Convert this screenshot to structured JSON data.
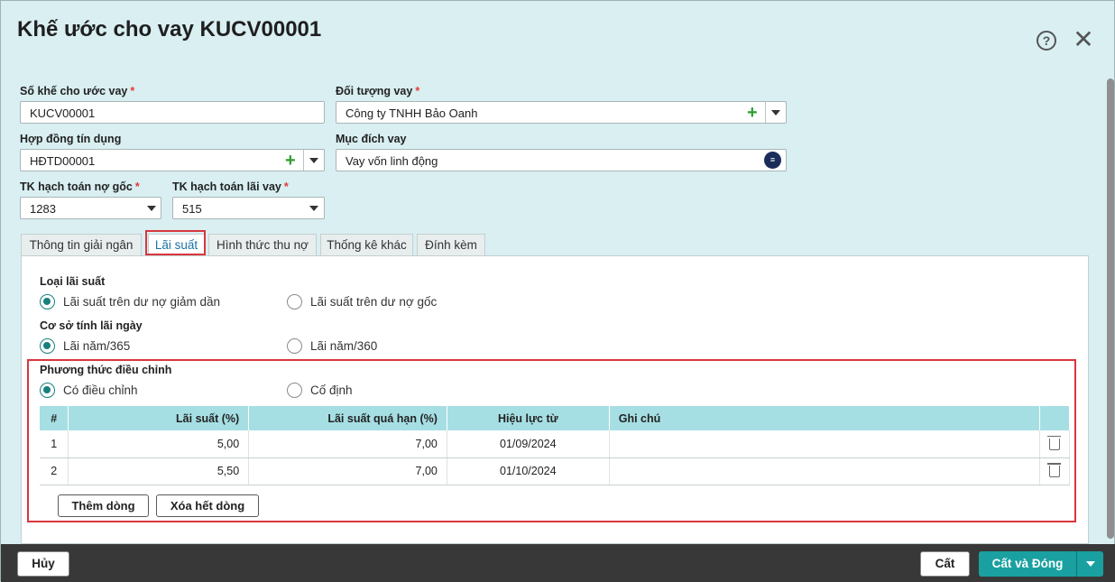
{
  "dialog": {
    "title": "Khế ước cho vay KUCV00001"
  },
  "form": {
    "so_khe_uoc": {
      "label": "Số khế cho ước vay",
      "value": "KUCV00001"
    },
    "doi_tuong_vay": {
      "label": "Đối tượng vay",
      "value": "Công ty TNHH Bảo Oanh"
    },
    "hop_dong": {
      "label": "Hợp đồng tín dụng",
      "value": "HĐTD00001"
    },
    "muc_dich": {
      "label": "Mục đích vay",
      "value": "Vay vốn linh động"
    },
    "tk_no_goc": {
      "label": "TK hạch toán nợ gốc",
      "value": "1283"
    },
    "tk_lai_vay": {
      "label": "TK hạch toán lãi vay",
      "value": "515"
    },
    "required_mark": "*"
  },
  "tabs": [
    "Thông tin giải ngân",
    "Lãi suất",
    "Hình thức thu nợ",
    "Thống kê khác",
    "Đính kèm"
  ],
  "interest": {
    "loai_label": "Loại lãi suất",
    "loai_opt1": "Lãi suất trên dư nợ giảm dần",
    "loai_opt2": "Lãi suất trên dư nợ gốc",
    "coso_label": "Cơ sở tính lãi ngày",
    "coso_opt1": "Lãi năm/365",
    "coso_opt2": "Lãi năm/360",
    "pt_label": "Phương thức điều chỉnh",
    "pt_opt1": "Có điều chỉnh",
    "pt_opt2": "Cố định"
  },
  "grid": {
    "headers": [
      "#",
      "Lãi suất (%)",
      "Lãi suất quá hạn (%)",
      "Hiệu lực từ",
      "Ghi chú"
    ],
    "rows": [
      {
        "idx": "1",
        "rate": "5,00",
        "overdue": "7,00",
        "from": "01/09/2024",
        "note": ""
      },
      {
        "idx": "2",
        "rate": "5,50",
        "overdue": "7,00",
        "from": "01/10/2024",
        "note": ""
      }
    ],
    "add_label": "Thêm dòng",
    "clear_label": "Xóa hết dòng"
  },
  "footer": {
    "cancel": "Hủy",
    "save": "Cất",
    "save_close": "Cất và Đóng"
  },
  "icons": {
    "help": "help-icon",
    "close": "close-icon",
    "plus": "plus-icon",
    "delete": "trash-icon",
    "ai": "ai-assist-icon"
  },
  "colors": {
    "accent": "#1aa0a0",
    "highlight": "#d9363e",
    "grid_header": "#a6dfe3"
  }
}
